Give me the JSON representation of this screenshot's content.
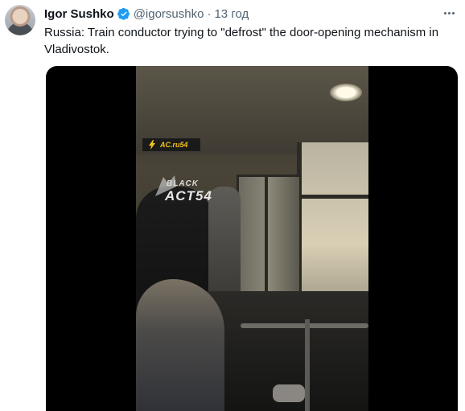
{
  "tweet": {
    "author_name": "Igor Sushko",
    "handle": "@igorsushko",
    "separator": "·",
    "time": "13 год",
    "text": "Russia: Train conductor trying to \"defrost\" the door-opening mechanism in Vladivostok."
  },
  "media": {
    "badge_text": "AC.ru54",
    "watermark_top": "BLACK",
    "watermark_bottom": "ACT54"
  },
  "colors": {
    "verified": "#1d9bf0",
    "secondary_text": "#536471",
    "badge_accent": "#f2c318"
  },
  "icons": [
    "avatar",
    "verified-badge-icon",
    "more-options-icon",
    "lightning-bolt-icon",
    "black-cat-watermark-icon"
  ]
}
